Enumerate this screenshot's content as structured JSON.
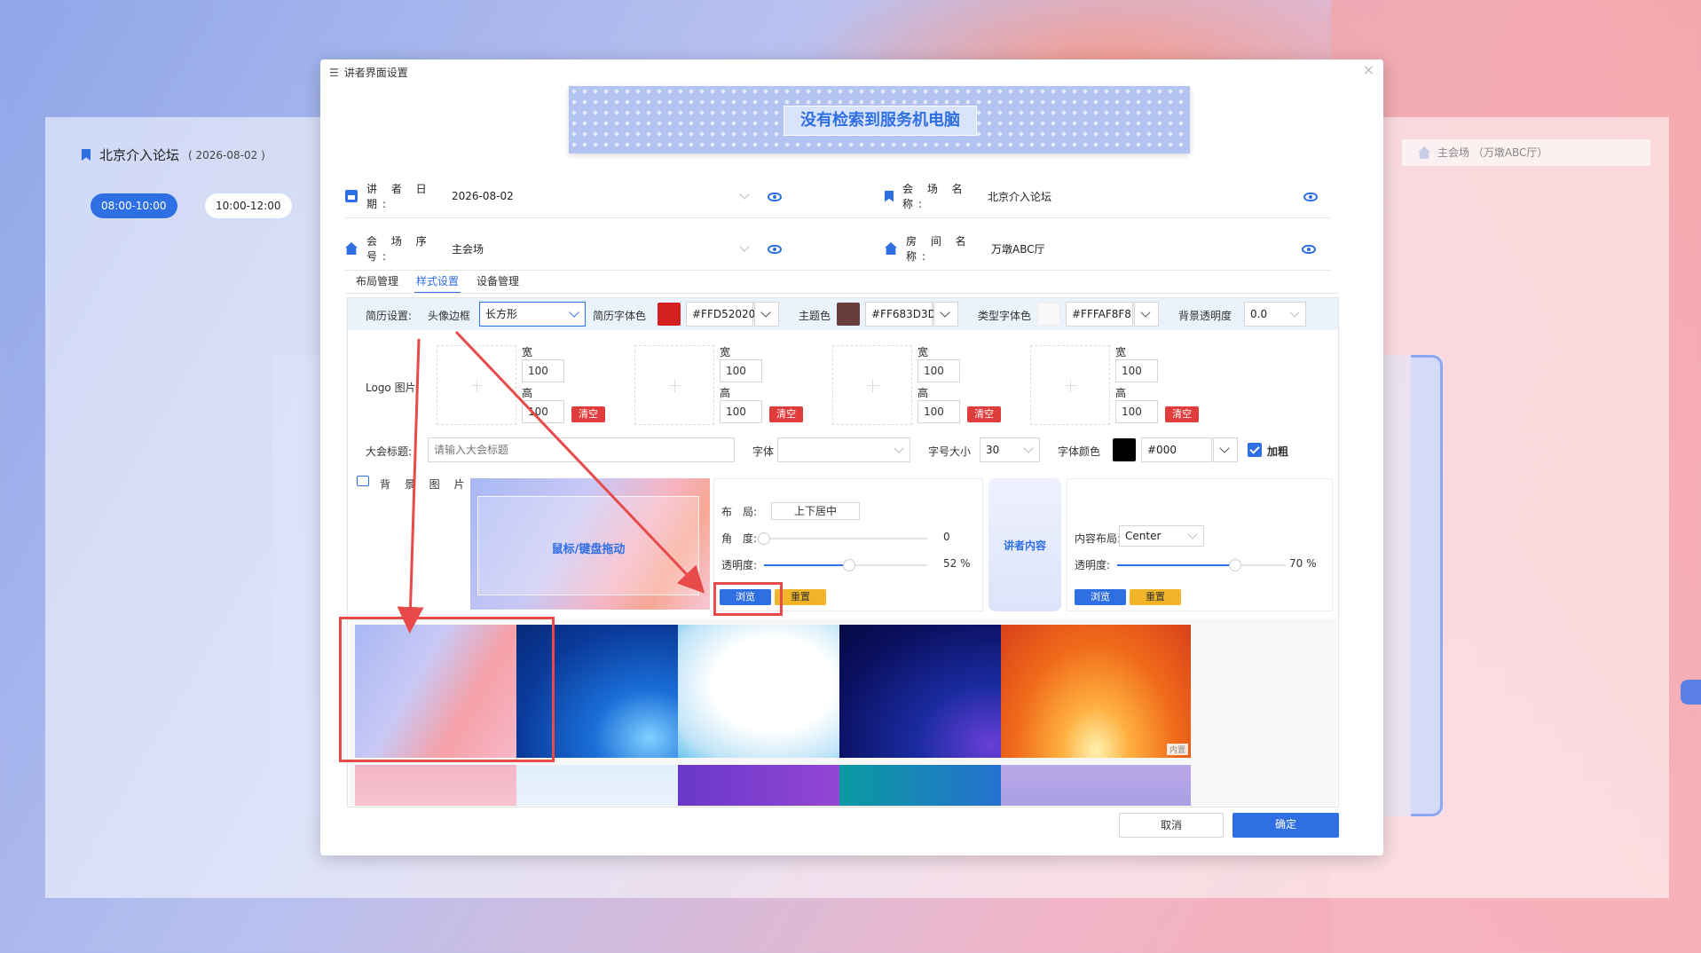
{
  "background_app": {
    "title": "北京介入论坛",
    "date": "( 2026-08-02 )",
    "time_slots": [
      "08:00-10:00",
      "10:00-12:00"
    ],
    "venue_chip": "主会场 （万墩ABC厅）"
  },
  "dialog": {
    "title": "讲者界面设置",
    "close": "×",
    "banner_text": "没有检索到服务机电脑",
    "info": {
      "date_label": "讲 者 日 期:",
      "date_value": "2026-08-02",
      "venue_name_label": "会 场 名 称:",
      "venue_name_value": "北京介入论坛",
      "venue_no_label": "会 场 序 号:",
      "venue_no_value": "主会场",
      "room_label": "房 间 名 称:",
      "room_value": "万墩ABC厅"
    },
    "tabs": [
      {
        "label": "布局管理",
        "active": false
      },
      {
        "label": "样式设置",
        "active": true
      },
      {
        "label": "设备管理",
        "active": false
      }
    ],
    "toolbar": {
      "resume_label": "简历设置:",
      "avatar_border_label": "头像边框",
      "avatar_border_value": "长方形",
      "resume_font_color_label": "简历字体色",
      "resume_font_color": "#FFD52020",
      "resume_font_color_hex": "#d52020",
      "theme_color_label": "主题色",
      "theme_color": "#FF683D3D",
      "theme_color_hex": "#683d3d",
      "type_font_color_label": "类型字体色",
      "type_font_color": "#FFFAF8F8",
      "type_font_color_hex": "#faf8f8",
      "bg_opacity_label": "背景透明度",
      "bg_opacity_value": "0.0"
    },
    "logo": {
      "label": "Logo 图片",
      "width_label": "宽",
      "height_label": "高",
      "items": [
        {
          "width": "100",
          "height": "100",
          "clear": "清空"
        },
        {
          "width": "100",
          "height": "100",
          "clear": "清空"
        },
        {
          "width": "100",
          "height": "100",
          "clear": "清空"
        },
        {
          "width": "100",
          "height": "100",
          "clear": "清空"
        }
      ]
    },
    "conference": {
      "title_label": "大会标题:",
      "title_placeholder": "请输入大会标题",
      "font_label": "字体",
      "font_value": "",
      "size_label": "字号大小",
      "size_value": "30",
      "color_label": "字体颜色",
      "color_value": "#000",
      "bold_label": "加粗",
      "bold_checked": true
    },
    "background": {
      "label": "背 景 图 片:",
      "preview_text": "鼠标/键盘拖动",
      "layout_label": "布　局:",
      "layout_value": "上下居中",
      "angle_label": "角　度:",
      "angle_value": "0",
      "angle_fraction": 0.0,
      "opacity_label": "透明度:",
      "opacity_value": "52 %",
      "opacity_fraction": 0.52,
      "browse": "浏览",
      "reset": "重置"
    },
    "speaker": {
      "label": "讲者内容",
      "layout_label": "内容布局:",
      "layout_value": "Center",
      "opacity_label": "透明度:",
      "opacity_value": "70 %",
      "opacity_fraction": 0.7,
      "browse": "浏览",
      "reset": "重置"
    },
    "thumb_tag": "内置",
    "buttons": {
      "cancel": "取消",
      "ok": "确定"
    }
  },
  "colors": {
    "primary": "#2f6fe4",
    "danger": "#e03c3c",
    "warning": "#f0b429",
    "annotation": "#e84a4a"
  }
}
